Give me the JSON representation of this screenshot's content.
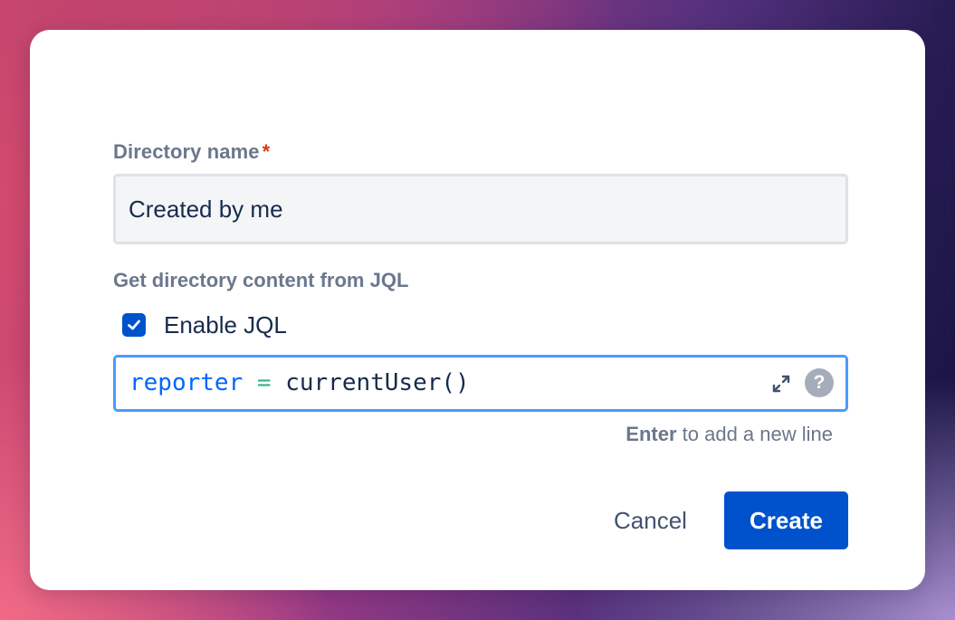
{
  "dialog": {
    "name_label": "Directory name",
    "required_marker": "*",
    "name_value": "Created by me",
    "jql_section_label": "Get directory content from JQL",
    "enable_jql": {
      "label": "Enable JQL",
      "checked": true
    },
    "jql": {
      "field": "reporter",
      "operator": "=",
      "function": "currentUser()"
    },
    "hint": {
      "key": "Enter",
      "text": " to add a new line"
    },
    "icons": {
      "expand": "expand-icon",
      "help": "help-icon",
      "help_glyph": "?",
      "check": "check-icon"
    },
    "buttons": {
      "cancel": "Cancel",
      "create": "Create"
    },
    "colors": {
      "primary": "#0052cc",
      "focus_border": "#4c9aff",
      "required": "#de350b",
      "jql_field": "#0065ff",
      "jql_operator": "#36b37e"
    }
  }
}
